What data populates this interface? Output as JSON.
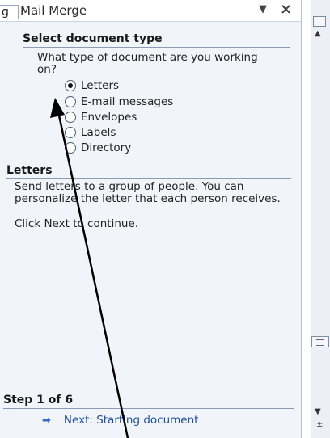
{
  "pane": {
    "title_prefix": "g",
    "title": "Mail Merge",
    "dropdown_glyph": "▼",
    "close_glyph": "×"
  },
  "select_type": {
    "heading": "Select document type",
    "question": "What type of document are you working on?",
    "options": [
      {
        "label": "Letters",
        "checked": true
      },
      {
        "label": "E-mail messages",
        "checked": false
      },
      {
        "label": "Envelopes",
        "checked": false
      },
      {
        "label": "Labels",
        "checked": false
      },
      {
        "label": "Directory",
        "checked": false
      }
    ]
  },
  "letters": {
    "heading": "Letters",
    "description": "Send letters to a group of people. You can personalize the letter that each person receives.",
    "instruction": "Click Next to continue."
  },
  "footer": {
    "step": "Step 1 of 6",
    "next_arrow_glyph": "➡",
    "next_link": "Next: Starting document"
  },
  "scroller": {
    "up_glyph": "▲",
    "down_glyph": "▼",
    "more_glyph": "±"
  },
  "colors": {
    "pane_bg": "#f1f4f9",
    "link": "#1f4ea0",
    "annotation_arrow": "#000000"
  }
}
